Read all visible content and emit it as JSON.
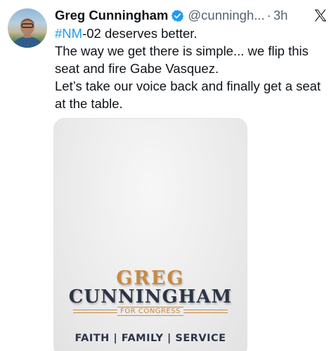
{
  "tweet": {
    "author_name": "Greg Cunningham",
    "handle": "@cunningh...",
    "separator": "·",
    "time": "3h",
    "body": {
      "hashtag": "#NM",
      "line1_rest": "-02 deserves better.",
      "line2": "The way we get there is simple... we flip this seat and fire Gabe Vasquez.",
      "line3": "Let’s take our voice back and finally get a seat at the table."
    },
    "media": {
      "logo_line1": "GREG",
      "logo_line2": "CUNNINGHAM",
      "logo_tagline": "FOR CONGRESS",
      "slogan": "FAITH | FAMILY | SERVICE"
    }
  },
  "icons": {
    "verified": "verified-badge-icon",
    "platform": "x-logo-icon"
  },
  "colors": {
    "accent": "#1d9bf0",
    "text": "#0f1419",
    "muted": "#536471",
    "logo_gold": "#c88a3f",
    "logo_navy": "#2b3547"
  }
}
